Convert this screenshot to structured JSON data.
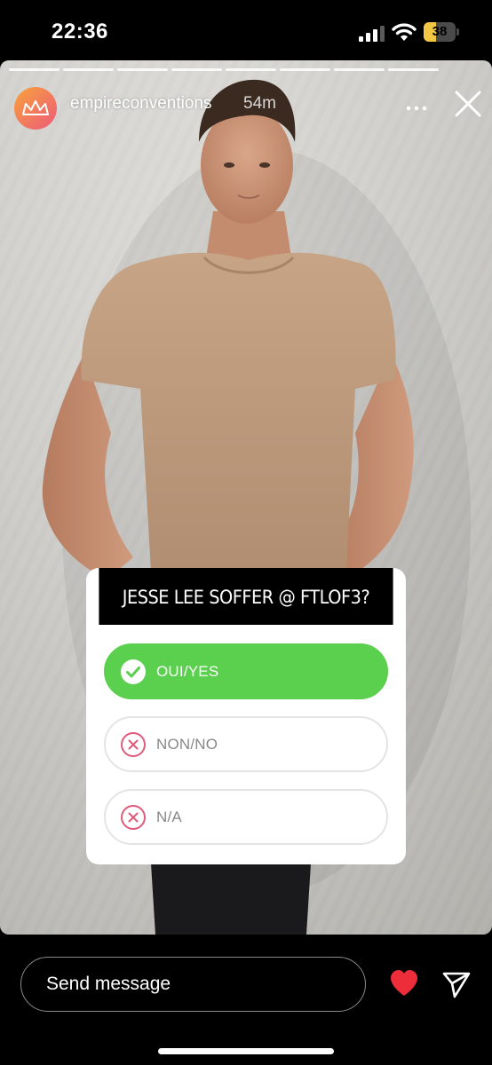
{
  "status_bar": {
    "time": "22:36",
    "battery": "38",
    "battery_level": 0.38,
    "battery_color": "#f2c744"
  },
  "story": {
    "segments": 8,
    "username": "empireconventions",
    "time_ago": "54m"
  },
  "poll": {
    "question": "JESSE LEE SOFFER @ FTLOF3?",
    "options": [
      {
        "label": "OUI/YES",
        "icon": "check-icon",
        "selected": true
      },
      {
        "label": "NON/NO",
        "icon": "x-circle-icon",
        "selected": false
      },
      {
        "label": "N/A",
        "icon": "x-circle-icon",
        "selected": false
      }
    ],
    "selected_color": "#5bcf4e"
  },
  "footer": {
    "message_placeholder": "Send message",
    "heart_color": "#ed2d3a"
  }
}
